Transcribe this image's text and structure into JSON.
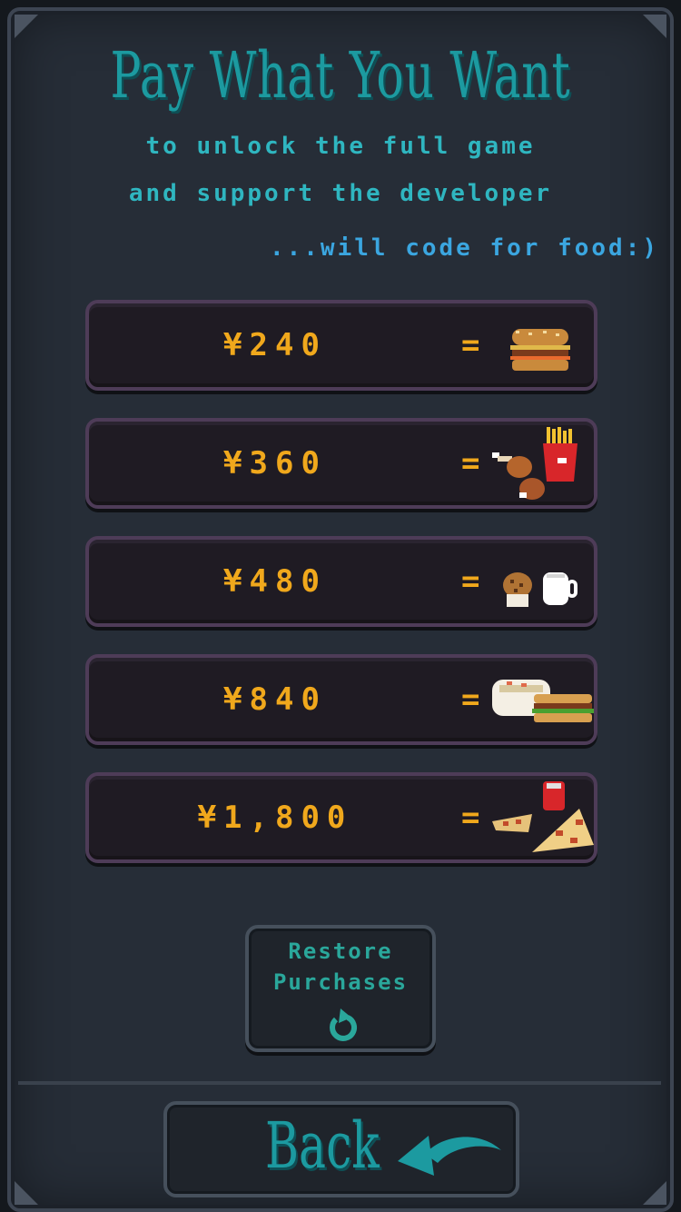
{
  "header": {
    "title": "Pay What You Want",
    "subtitle_line1": "to unlock the full game",
    "subtitle_line2": "and support the developer",
    "tagline": "...will code for food:)"
  },
  "tiers": [
    {
      "price": "¥240",
      "equals": "=",
      "food_icon": "burger-icon"
    },
    {
      "price": "¥360",
      "equals": "=",
      "food_icon": "fries-chicken-icon"
    },
    {
      "price": "¥480",
      "equals": "=",
      "food_icon": "muffin-coffee-icon"
    },
    {
      "price": "¥840",
      "equals": "=",
      "food_icon": "noodles-sandwich-icon"
    },
    {
      "price": "¥1,800",
      "equals": "=",
      "food_icon": "pizza-soda-icon"
    }
  ],
  "restore": {
    "label_line1": "Restore",
    "label_line2": "Purchases",
    "icon": "refresh-icon"
  },
  "back": {
    "label": "Back",
    "icon": "back-arrow-icon"
  },
  "colors": {
    "title": "#1c9aa0",
    "subtitle": "#2fb6c0",
    "tagline": "#3ba6e0",
    "price": "#f0a81c",
    "panel": "#262d37",
    "tier_border": "#4e3c58"
  }
}
